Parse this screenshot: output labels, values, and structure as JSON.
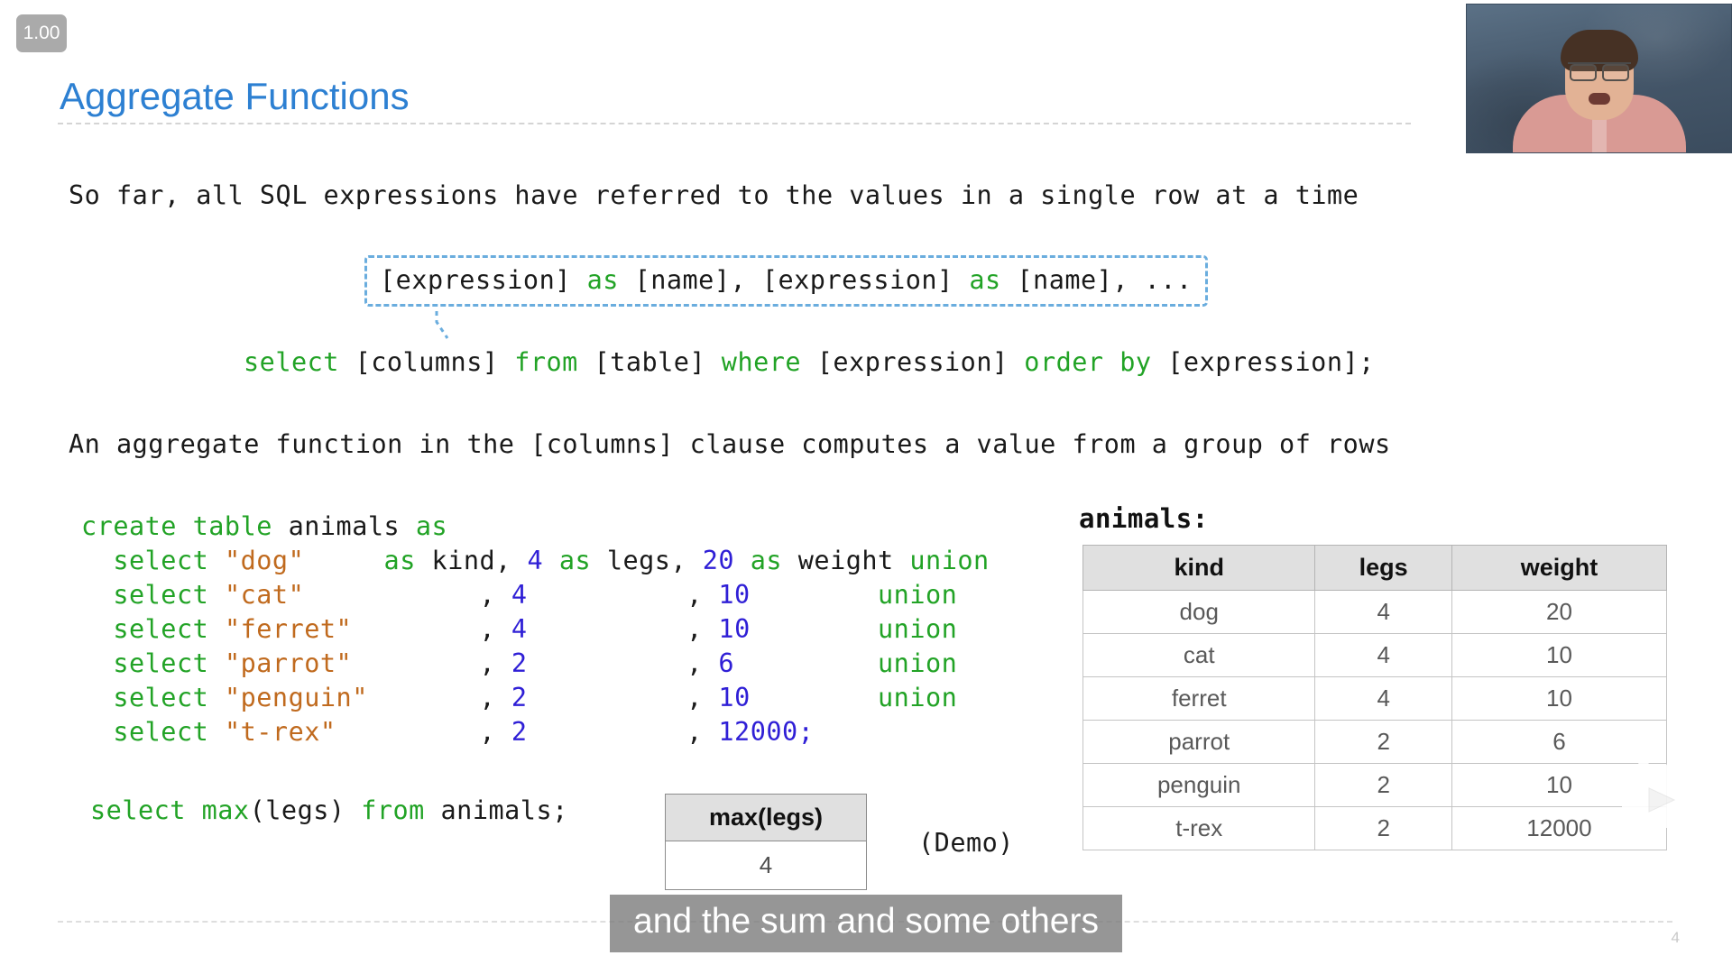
{
  "player": {
    "speed_label": "1.00",
    "play_watermark_icon": "bilibili-play-icon",
    "video_thumbnail_name": "lecturer-webcam"
  },
  "slide": {
    "title": "Aggregate Functions",
    "number": "4",
    "intro_line": "So far, all SQL expressions have referred to the values in a single row at a time",
    "callout": {
      "segments": [
        {
          "text": "[expression] ",
          "cls": "pln"
        },
        {
          "text": "as",
          "cls": "kw"
        },
        {
          "text": " [name], [expression] ",
          "cls": "pln"
        },
        {
          "text": "as",
          "cls": "kw"
        },
        {
          "text": " [name], ...",
          "cls": "pln"
        }
      ]
    },
    "select_template": {
      "segments": [
        {
          "text": "select",
          "cls": "kw"
        },
        {
          "text": " [columns] ",
          "cls": "pln"
        },
        {
          "text": "from",
          "cls": "kw"
        },
        {
          "text": " [table] ",
          "cls": "pln"
        },
        {
          "text": "where",
          "cls": "kw"
        },
        {
          "text": " [expression] ",
          "cls": "pln"
        },
        {
          "text": "order by",
          "cls": "kw"
        },
        {
          "text": " [expression];",
          "cls": "pln"
        }
      ]
    },
    "agg_line": "An aggregate function in the [columns] clause computes a value from a group of rows",
    "demo_label": "(Demo)"
  },
  "code": {
    "lines": [
      [
        {
          "text": "create table",
          "cls": "kw"
        },
        {
          "text": " animals ",
          "cls": "pln"
        },
        {
          "text": "as",
          "cls": "kw"
        }
      ],
      [
        {
          "text": "  select",
          "cls": "kw"
        },
        {
          "text": " ",
          "cls": "pln"
        },
        {
          "text": "\"dog\"",
          "cls": "str"
        },
        {
          "text": "     ",
          "cls": "pln"
        },
        {
          "text": "as",
          "cls": "kw"
        },
        {
          "text": " kind, ",
          "cls": "pln"
        },
        {
          "text": "4",
          "cls": "num"
        },
        {
          "text": " ",
          "cls": "pln"
        },
        {
          "text": "as",
          "cls": "kw"
        },
        {
          "text": " legs, ",
          "cls": "pln"
        },
        {
          "text": "20",
          "cls": "num"
        },
        {
          "text": " ",
          "cls": "pln"
        },
        {
          "text": "as",
          "cls": "kw"
        },
        {
          "text": " weight ",
          "cls": "pln"
        },
        {
          "text": "union",
          "cls": "kw"
        }
      ],
      [
        {
          "text": "  select",
          "cls": "kw"
        },
        {
          "text": " ",
          "cls": "pln"
        },
        {
          "text": "\"cat\"",
          "cls": "str"
        },
        {
          "text": "           , ",
          "cls": "pln"
        },
        {
          "text": "4",
          "cls": "num"
        },
        {
          "text": "          , ",
          "cls": "pln"
        },
        {
          "text": "10",
          "cls": "num"
        },
        {
          "text": "        ",
          "cls": "pln"
        },
        {
          "text": "union",
          "cls": "kw"
        }
      ],
      [
        {
          "text": "  select",
          "cls": "kw"
        },
        {
          "text": " ",
          "cls": "pln"
        },
        {
          "text": "\"ferret\"",
          "cls": "str"
        },
        {
          "text": "        , ",
          "cls": "pln"
        },
        {
          "text": "4",
          "cls": "num"
        },
        {
          "text": "          , ",
          "cls": "pln"
        },
        {
          "text": "10",
          "cls": "num"
        },
        {
          "text": "        ",
          "cls": "pln"
        },
        {
          "text": "union",
          "cls": "kw"
        }
      ],
      [
        {
          "text": "  select",
          "cls": "kw"
        },
        {
          "text": " ",
          "cls": "pln"
        },
        {
          "text": "\"parrot\"",
          "cls": "str"
        },
        {
          "text": "        , ",
          "cls": "pln"
        },
        {
          "text": "2",
          "cls": "num"
        },
        {
          "text": "          , ",
          "cls": "pln"
        },
        {
          "text": "6",
          "cls": "num"
        },
        {
          "text": "         ",
          "cls": "pln"
        },
        {
          "text": "union",
          "cls": "kw"
        }
      ],
      [
        {
          "text": "  select",
          "cls": "kw"
        },
        {
          "text": " ",
          "cls": "pln"
        },
        {
          "text": "\"penguin\"",
          "cls": "str"
        },
        {
          "text": "       , ",
          "cls": "pln"
        },
        {
          "text": "2",
          "cls": "num"
        },
        {
          "text": "          , ",
          "cls": "pln"
        },
        {
          "text": "10",
          "cls": "num"
        },
        {
          "text": "        ",
          "cls": "pln"
        },
        {
          "text": "union",
          "cls": "kw"
        }
      ],
      [
        {
          "text": "  select",
          "cls": "kw"
        },
        {
          "text": " ",
          "cls": "pln"
        },
        {
          "text": "\"t-rex\"",
          "cls": "str"
        },
        {
          "text": "         , ",
          "cls": "pln"
        },
        {
          "text": "2",
          "cls": "num"
        },
        {
          "text": "          , ",
          "cls": "pln"
        },
        {
          "text": "12000;",
          "cls": "num"
        }
      ]
    ],
    "final_line": [
      {
        "text": "select max",
        "cls": "kw"
      },
      {
        "text": "(legs) ",
        "cls": "pln"
      },
      {
        "text": "from",
        "cls": "kw"
      },
      {
        "text": " animals;",
        "cls": "pln"
      }
    ]
  },
  "animals_table": {
    "label": "animals:",
    "columns": [
      "kind",
      "legs",
      "weight"
    ],
    "rows": [
      [
        "dog",
        "4",
        "20"
      ],
      [
        "cat",
        "4",
        "10"
      ],
      [
        "ferret",
        "4",
        "10"
      ],
      [
        "parrot",
        "2",
        "6"
      ],
      [
        "penguin",
        "2",
        "10"
      ],
      [
        "t-rex",
        "2",
        "12000"
      ]
    ]
  },
  "result_table": {
    "columns": [
      "max(legs)"
    ],
    "rows": [
      [
        "4"
      ]
    ]
  },
  "caption": {
    "text": "and the sum and some others"
  },
  "colors": {
    "title_blue": "#2d80d2",
    "keyword_green": "#22a326",
    "string_orange": "#c06a1e",
    "number_blue": "#2f1fd6",
    "callout_border": "#6aadde",
    "table_header_bg": "#e0e0e0",
    "caption_bg": "rgba(120,120,120,0.78)"
  }
}
